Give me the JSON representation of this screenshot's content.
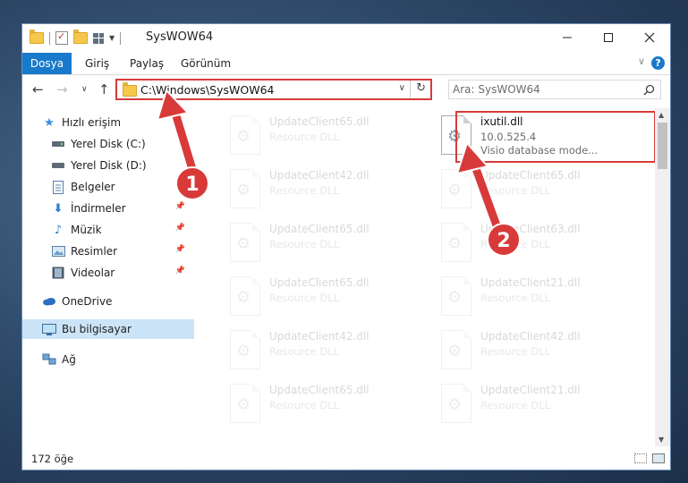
{
  "window": {
    "title": "SysWOW64"
  },
  "ribbon": {
    "tabs": [
      "Dosya",
      "Giriş",
      "Paylaş",
      "Görünüm"
    ],
    "help": "?"
  },
  "address_bar": {
    "path": "C:\\Windows\\SysWOW64",
    "search_placeholder": "Ara: SysWOW64"
  },
  "nav": {
    "quick_access": "Hızlı erişim",
    "items": [
      {
        "label": "Yerel Disk (C:)",
        "icon": "drive-icon",
        "pinned": true
      },
      {
        "label": "Yerel Disk (D:)",
        "icon": "drive-icon",
        "pinned": false
      },
      {
        "label": "Belgeler",
        "icon": "documents-icon",
        "pinned": true
      },
      {
        "label": "İndirmeler",
        "icon": "downloads-icon",
        "pinned": true
      },
      {
        "label": "Müzik",
        "icon": "music-icon",
        "pinned": true
      },
      {
        "label": "Resimler",
        "icon": "pictures-icon",
        "pinned": true
      },
      {
        "label": "Videolar",
        "icon": "videos-icon",
        "pinned": true
      }
    ],
    "onedrive": "OneDrive",
    "this_pc": "Bu bilgisayar",
    "network": "Ağ"
  },
  "files": {
    "highlighted": {
      "name": "ixutil.dll",
      "version": "10.0.525.4",
      "description": "Visio database mode..."
    },
    "left_column": [
      {
        "name": "UpdateClient65.dll",
        "type": "Resource DLL"
      },
      {
        "name": "UpdateClient42.dll",
        "type": "Resource DLL"
      },
      {
        "name": "UpdateClient65.dll",
        "type": "Resource DLL"
      },
      {
        "name": "UpdateClient65.dll",
        "type": "Resource DLL"
      },
      {
        "name": "UpdateClient42.dll",
        "type": "Resource DLL"
      },
      {
        "name": "UpdateClient65.dll",
        "type": "Resource DLL"
      }
    ],
    "right_column": [
      {
        "name": "UpdateClient65.dll",
        "type": "Resource DLL"
      },
      {
        "name": "UpdateClient63.dll",
        "type": "Resource DLL"
      },
      {
        "name": "UpdateClient21.dll",
        "type": "Resource DLL"
      },
      {
        "name": "UpdateClient42.dll",
        "type": "Resource DLL"
      },
      {
        "name": "UpdateClient21.dll",
        "type": "Resource DLL"
      }
    ]
  },
  "status": {
    "item_count": "172 öğe"
  },
  "annotations": {
    "step1": "1",
    "step2": "2",
    "color": "#d83a3a"
  }
}
